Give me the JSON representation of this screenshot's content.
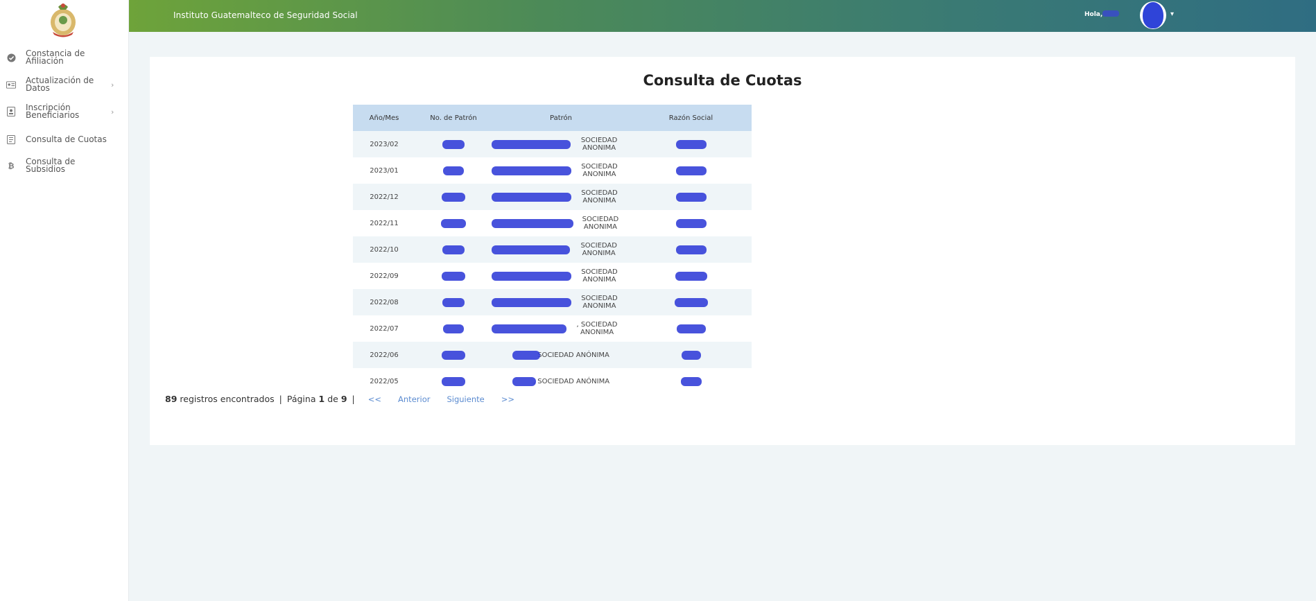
{
  "header": {
    "title": "Instituto Guatemalteco de Seguridad Social",
    "greeting": "Hola, ",
    "accent": "#4c8a58"
  },
  "sidebar": {
    "items": [
      {
        "label": "Constancia de Afiliación",
        "icon": "check-circle-icon",
        "has_submenu": false
      },
      {
        "label": "Actualización de Datos",
        "icon": "id-card-icon",
        "has_submenu": true
      },
      {
        "label": "Inscripción Beneficiarios",
        "icon": "badge-icon",
        "has_submenu": true
      },
      {
        "label": "Consulta de Cuotas",
        "icon": "document-icon",
        "has_submenu": false
      },
      {
        "label": "Consulta de Subsidios",
        "icon": "coin-icon",
        "has_submenu": false
      }
    ]
  },
  "main": {
    "title": "Consulta de Cuotas",
    "table": {
      "headers": [
        "Año/Mes",
        "No. de Patrón",
        "Patrón",
        "Razón Social"
      ],
      "rows": [
        {
          "period": "2023/02",
          "patron_suffix": "SOCIEDAD ANONIMA"
        },
        {
          "period": "2023/01",
          "patron_suffix": "SOCIEDAD ANONIMA"
        },
        {
          "period": "2022/12",
          "patron_suffix": "SOCIEDAD ANONIMA"
        },
        {
          "period": "2022/11",
          "patron_suffix": "SOCIEDAD ANONIMA"
        },
        {
          "period": "2022/10",
          "patron_suffix": "SOCIEDAD ANONIMA"
        },
        {
          "period": "2022/09",
          "patron_suffix": "SOCIEDAD ANONIMA"
        },
        {
          "period": "2022/08",
          "patron_suffix": "SOCIEDAD ANONIMA"
        },
        {
          "period": "2022/07",
          "patron_suffix": ", SOCIEDAD ANONIMA"
        },
        {
          "period": "2022/06",
          "patron_suffix": "SOCIEDAD ANÓNIMA"
        },
        {
          "period": "2022/05",
          "patron_suffix": ", SOCIEDAD ANÓNIMA"
        }
      ]
    },
    "pagination": {
      "total": "89",
      "records_text": "registros encontrados",
      "page_label": "Página",
      "page": "1",
      "of_label": "de",
      "pages": "9",
      "first": "<<",
      "prev": "Anterior",
      "next": "Siguiente",
      "last": ">>"
    }
  }
}
